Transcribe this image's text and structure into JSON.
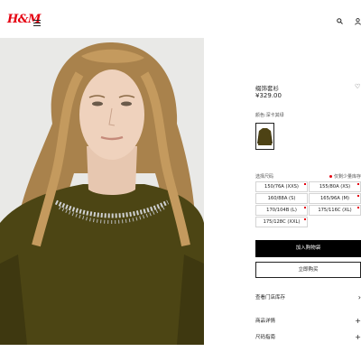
{
  "header": {
    "logo": "H&M",
    "menu_icon": "hamburger-menu-icon",
    "search_icon": "search-icon",
    "account_icon": "user-icon",
    "brand_color": "#e50010"
  },
  "product": {
    "title": "缀饰套衫",
    "price": "¥329.00",
    "color_label": "颜色:深卡其绿",
    "color_swatch_color": "#4d4214",
    "size_label": "选择尺码",
    "low_stock_note": "仅剩少量库存",
    "sizes": [
      {
        "label": "150/76A (XXS)",
        "low_stock": true
      },
      {
        "label": "155/80A (XS)",
        "low_stock": true
      },
      {
        "label": "160/88A (S)",
        "low_stock": false
      },
      {
        "label": "165/96A (M)",
        "low_stock": true
      },
      {
        "label": "170/104B (L)",
        "low_stock": true
      },
      {
        "label": "175/116C (XL)",
        "low_stock": true
      },
      {
        "label": "175/128C (XXL)",
        "low_stock": true
      }
    ],
    "add_to_bag": "加入购物袋",
    "buy_now": "立即购买",
    "store_stock": "查看门店库存",
    "details": "商品详情",
    "size_guide": "尺码指南"
  },
  "photo": {
    "sweater_color": "#4c4514",
    "hair_color": "#b58a52",
    "background_color": "#e9e9e7"
  }
}
